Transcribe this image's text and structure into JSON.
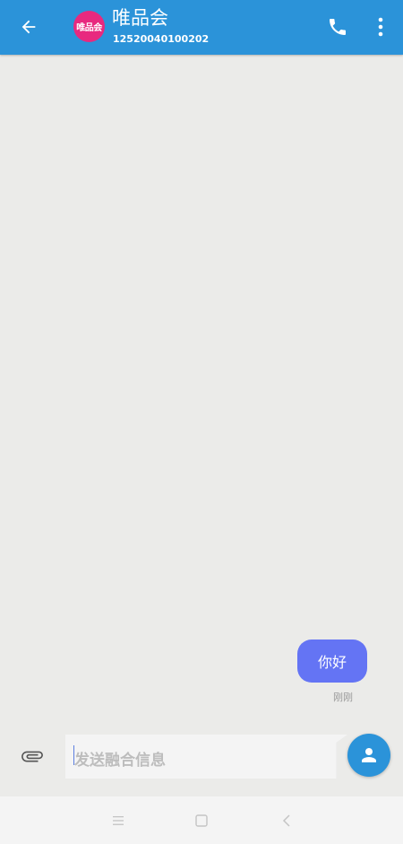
{
  "header": {
    "title": "唯品会",
    "subtitle": "12520040100202",
    "avatar_text": "唯品会",
    "back_icon": "arrow-left-icon",
    "phone_icon": "phone-icon",
    "more_icon": "more-vert-icon"
  },
  "messages": [
    {
      "text": "你好",
      "time": "刚刚",
      "direction": "outgoing"
    }
  ],
  "composer": {
    "placeholder": "发送融合信息",
    "attach_icon": "paperclip-icon",
    "send_icon": "person-icon"
  },
  "nav": {
    "menu_icon": "menu-icon",
    "home_icon": "square-icon",
    "back_icon": "chevron-left-icon"
  },
  "colors": {
    "appbar": "#2b93d9",
    "bubble": "#6474f4",
    "avatar": "#e8297f",
    "background": "#ebebe9"
  }
}
